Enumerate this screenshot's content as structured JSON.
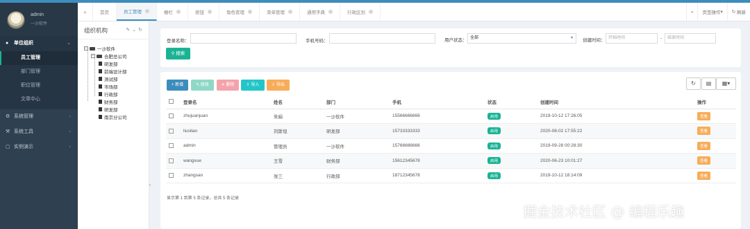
{
  "sidebar": {
    "user_name": "admin",
    "company": "一沙软件",
    "groups": [
      {
        "label": "单位组织",
        "icon": "user-icon",
        "expanded": true,
        "items": [
          {
            "label": "员工管理"
          },
          {
            "label": "部门管理"
          },
          {
            "label": "职位管理"
          },
          {
            "label": "文章中心"
          }
        ]
      },
      {
        "label": "系统管理",
        "icon": "gear-icon"
      },
      {
        "label": "系统工具",
        "icon": "tools-icon"
      },
      {
        "label": "实例演示",
        "icon": "desktop-icon"
      }
    ]
  },
  "tabs": [
    "首页",
    "员工管理",
    "栅栏",
    "按钮",
    "角色管理",
    "菜单管理",
    "通用字典",
    "行政区划"
  ],
  "tabbar_right": {
    "page_ops": "页签操作",
    "refresh": "刷新"
  },
  "tree": {
    "title": "组织机构",
    "root": "一沙软件",
    "branch": "合肥总公司",
    "children": [
      "研发部",
      "前端设计部",
      "测试部",
      "市场部",
      "行政部",
      "财务部",
      "研发部"
    ],
    "other": "南京分公司"
  },
  "search": {
    "login_name_label": "登录名称：",
    "phone_label": "手机号码：",
    "status_label": "用户状态：",
    "status_value": "全部",
    "created_label": "创建时间：",
    "start_placeholder": "开始时间",
    "dash": "-",
    "end_placeholder": "结束时间",
    "search_button": "搜索"
  },
  "toolbar": {
    "add": "新增",
    "edit": "修改",
    "delete": "删除",
    "import": "导入",
    "export": "导出"
  },
  "table": {
    "headers": [
      "登录名",
      "姓名",
      "部门",
      "手机",
      "状态",
      "创建时间",
      "操作"
    ],
    "rows": [
      {
        "login": "zhujuanjuan",
        "name": "朱娟",
        "dept": "一沙软件",
        "phone": "15566666666",
        "status": "启用",
        "created": "2019-10-12 17:26:05",
        "op": "查看"
      },
      {
        "login": "liusitan",
        "name": "刘斯坦",
        "dept": "研发部",
        "phone": "15733333333",
        "status": "启用",
        "created": "2020-08-02 17:55:22",
        "op": "查看"
      },
      {
        "login": "admin",
        "name": "管理员",
        "dept": "一沙软件",
        "phone": "15766666666",
        "status": "启用",
        "created": "2019-09-28 00:28:30",
        "op": "查看"
      },
      {
        "login": "wangxue",
        "name": "王雪",
        "dept": "财务部",
        "phone": "15612345678",
        "status": "启用",
        "created": "2020-06-23 10:01:27",
        "op": "查看"
      },
      {
        "login": "zhangsan",
        "name": "张三",
        "dept": "行政部",
        "phone": "18712345678",
        "status": "启用",
        "created": "2019-10-12 18:14:09",
        "op": "查看"
      }
    ],
    "footer": "显示第 1 到第 5 条记录，总共 5 条记录"
  },
  "watermark": "掘金技术社区 @ 编程乐趣",
  "colors": {
    "sidebar": "#2f4050",
    "primary": "#1ab394",
    "info": "#3c8dbc",
    "warning": "#f8ac59",
    "danger": "#ed5565"
  }
}
